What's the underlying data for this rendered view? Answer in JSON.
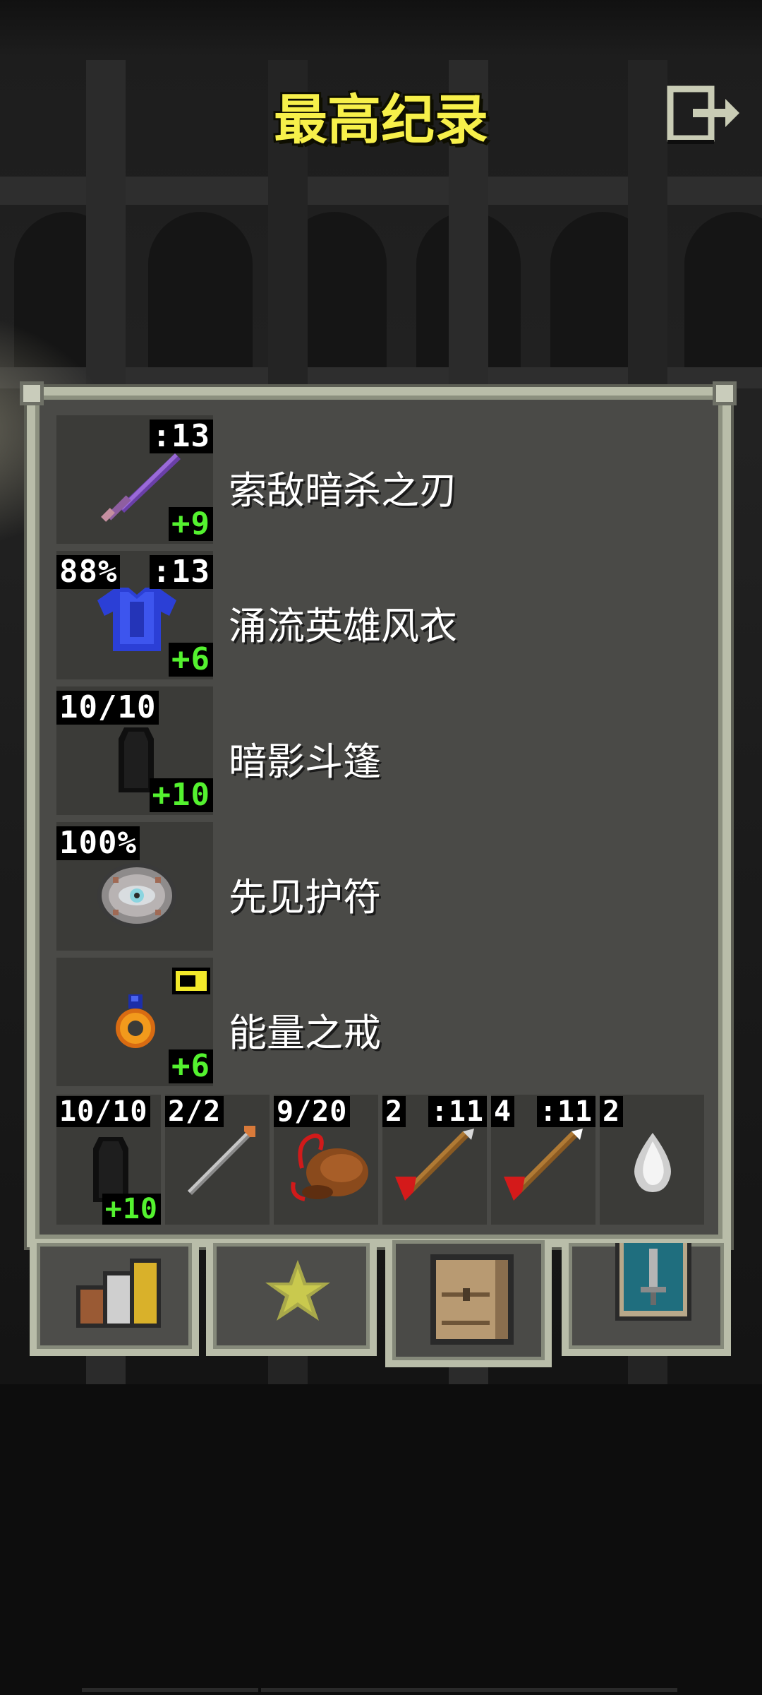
{
  "header": {
    "title": "最高纪录",
    "exit_icon": "exit-door-icon"
  },
  "equipment": [
    {
      "name": "索敌暗杀之刃",
      "icon": "purple-sword-icon",
      "top_left": "",
      "top_right": ":13",
      "bonus": "+9"
    },
    {
      "name": "涌流英雄风衣",
      "icon": "blue-armor-icon",
      "top_left": "88%",
      "top_right": ":13",
      "bonus": "+6"
    },
    {
      "name": "暗影斗篷",
      "icon": "shadow-cloak-icon",
      "top_left": "10/10",
      "top_right": "",
      "bonus": "+10"
    },
    {
      "name": "先见护符",
      "icon": "eye-amulet-icon",
      "top_left": "100%",
      "top_right": "",
      "bonus": ""
    },
    {
      "name": "能量之戒",
      "icon": "energy-ring-icon",
      "top_left": "",
      "top_right": "",
      "bonus": "+6",
      "badge_color": "#f2e92a"
    }
  ],
  "quickslots": [
    {
      "icon": "shadow-cloak-icon",
      "label_left": "10/10",
      "label_right": "",
      "bonus": "+10"
    },
    {
      "icon": "wand-icon",
      "label_left": "2/2",
      "label_right": "",
      "bonus": ""
    },
    {
      "icon": "whip-horn-icon",
      "label_left": "9/20",
      "label_right": "",
      "bonus": ""
    },
    {
      "icon": "red-dart-icon",
      "label_left": "2",
      "label_right": ":11",
      "bonus": ""
    },
    {
      "icon": "red-dart-icon",
      "label_left": "4",
      "label_right": ":11",
      "bonus": ""
    },
    {
      "icon": "white-seed-icon",
      "label_left": "2",
      "label_right": "",
      "bonus": ""
    }
  ],
  "tabs": [
    {
      "icon": "stats-icon",
      "active": false
    },
    {
      "icon": "star-badge-icon",
      "active": false
    },
    {
      "icon": "backpack-icon",
      "active": true
    },
    {
      "icon": "sword-journal-icon",
      "active": false
    }
  ],
  "colors": {
    "title": "#f7f04a",
    "bonus": "#54f22f",
    "panel": "#4a4a47",
    "frame": "#b9bda9"
  }
}
